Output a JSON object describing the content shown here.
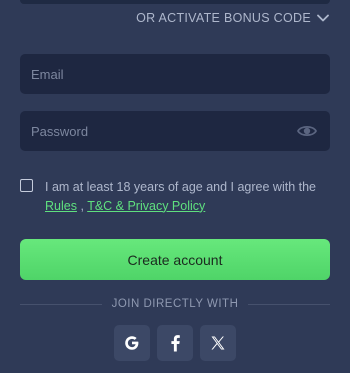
{
  "bonus": {
    "label": "OR ACTIVATE BONUS CODE",
    "icon": "chevron-down-icon"
  },
  "form": {
    "email_placeholder": "Email",
    "email_value": "",
    "password_placeholder": "Password",
    "password_value": "",
    "password_toggle_icon": "eye-icon"
  },
  "agreement": {
    "text": "I am at least 18 years of age and I agree with the",
    "rules_link": "Rules",
    "separator": ",",
    "privacy_link": "T&C & Privacy Policy",
    "checked": false
  },
  "actions": {
    "create_account": "Create account"
  },
  "social": {
    "divider_label": "JOIN DIRECTLY WITH",
    "providers": [
      {
        "name": "google",
        "glyph": "G",
        "icon": "google-icon"
      },
      {
        "name": "facebook",
        "glyph": "f",
        "icon": "facebook-icon"
      },
      {
        "name": "x",
        "glyph": "X",
        "icon": "x-icon"
      }
    ]
  },
  "colors": {
    "background": "#2f3a57",
    "field_background": "#1e2741",
    "accent_green": "#5fe07f",
    "social_button": "#3c4866"
  }
}
